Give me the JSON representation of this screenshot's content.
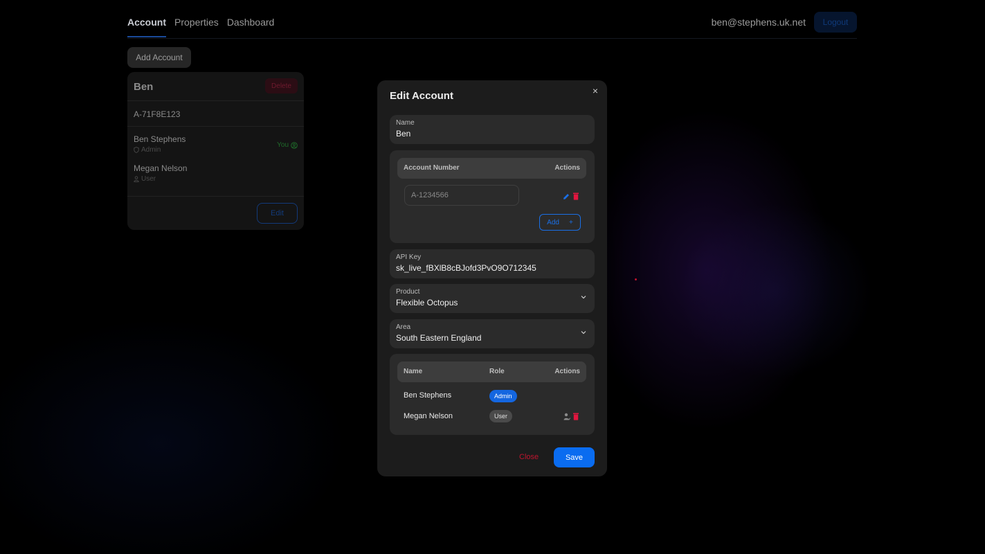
{
  "nav": {
    "tabs": [
      {
        "label": "Account",
        "active": true
      },
      {
        "label": "Properties",
        "active": false
      },
      {
        "label": "Dashboard",
        "active": false
      }
    ],
    "user_email": "ben@stephens.uk.net",
    "logout_label": "Logout"
  },
  "add_account_label": "Add Account",
  "card": {
    "title": "Ben",
    "delete_label": "Delete",
    "account_number": "A-71F8E123",
    "members": [
      {
        "name": "Ben Stephens",
        "role": "Admin",
        "you_label": "You"
      },
      {
        "name": "Megan Nelson",
        "role": "User"
      }
    ],
    "edit_label": "Edit"
  },
  "modal": {
    "title": "Edit Account",
    "close_icon": "×",
    "name": {
      "label": "Name",
      "value": "Ben"
    },
    "accounts_table": {
      "headers": {
        "account_number": "Account Number",
        "actions": "Actions"
      },
      "rows": [
        {
          "account_number": "A-1234566"
        }
      ],
      "add_label": "Add",
      "add_icon": "+"
    },
    "api_key": {
      "label": "API Key",
      "value": "sk_live_fBXlB8cBJofd3PvO9O712345"
    },
    "product": {
      "label": "Product",
      "value": "Flexible Octopus"
    },
    "area": {
      "label": "Area",
      "value": "South Eastern England"
    },
    "users_table": {
      "headers": {
        "name": "Name",
        "role": "Role",
        "actions": "Actions"
      },
      "rows": [
        {
          "name": "Ben Stephens",
          "role": "Admin"
        },
        {
          "name": "Megan Nelson",
          "role": "User"
        }
      ]
    },
    "close_label": "Close",
    "save_label": "Save"
  },
  "colors": {
    "accent": "#0a6cf0",
    "danger": "#c0142e",
    "modal_bg": "#1c1c1c",
    "field_bg": "#2b2b2b"
  }
}
